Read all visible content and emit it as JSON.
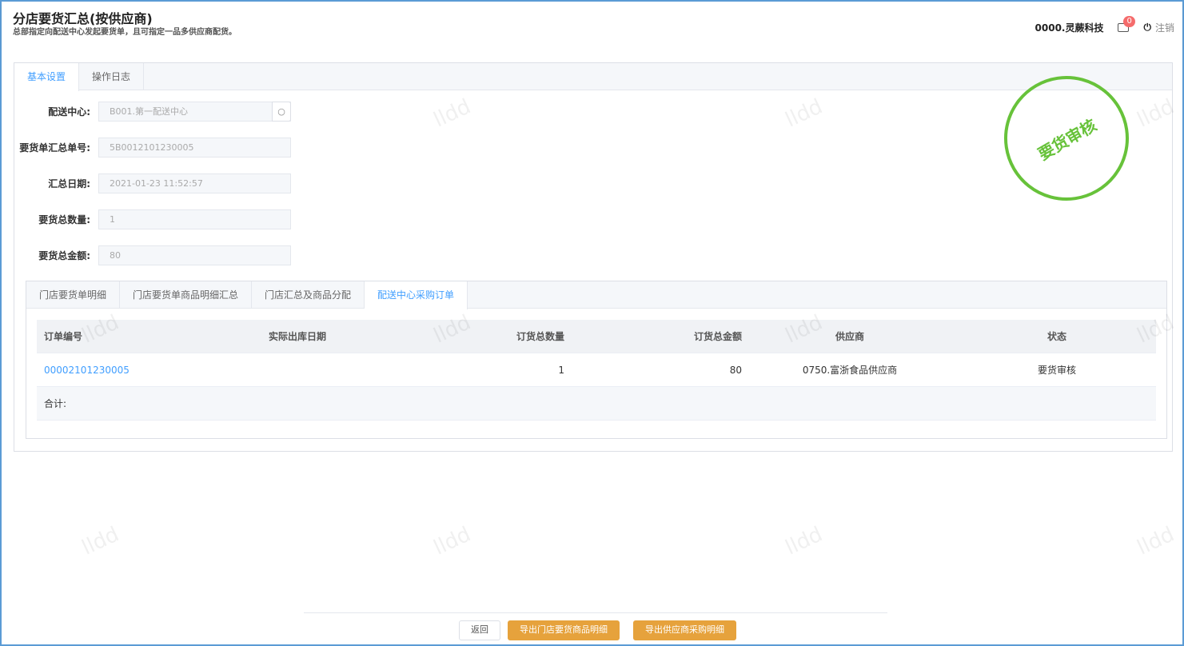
{
  "header": {
    "title": "分店要货汇总(按供应商)",
    "subtitle": "总部指定向配送中心发起要货单，且可指定一品多供应商配货。",
    "user": "0000.灵蕨科技",
    "badge": "0",
    "logout": "注销"
  },
  "tabs": [
    "基本设置",
    "操作日志"
  ],
  "form": [
    {
      "label": "配送中心:",
      "value": "B001.第一配送中心"
    },
    {
      "label": "要货单汇总单号:",
      "value": "5B0012101230005"
    },
    {
      "label": "汇总日期:",
      "value": "2021-01-23 11:52:57"
    },
    {
      "label": "要货总数量:",
      "value": "1"
    },
    {
      "label": "要货总金额:",
      "value": "80"
    }
  ],
  "stamp": "要货审核",
  "subtabs": [
    "门店要货单明细",
    "门店要货单商品明细汇总",
    "门店汇总及商品分配",
    "配送中心采购订单"
  ],
  "table": {
    "headers": [
      "订单编号",
      "实际出库日期",
      "订货总数量",
      "订货总金额",
      "供应商",
      "状态"
    ],
    "rows": [
      [
        "00002101230005",
        "",
        "1",
        "80",
        "0750.富浙食品供应商",
        "要货审核"
      ]
    ],
    "total": "合计:"
  },
  "buttons": {
    "back": "返回",
    "export_store": "导出门店要货商品明细",
    "export_supplier": "导出供应商采购明细"
  },
  "watermark": "lldd"
}
